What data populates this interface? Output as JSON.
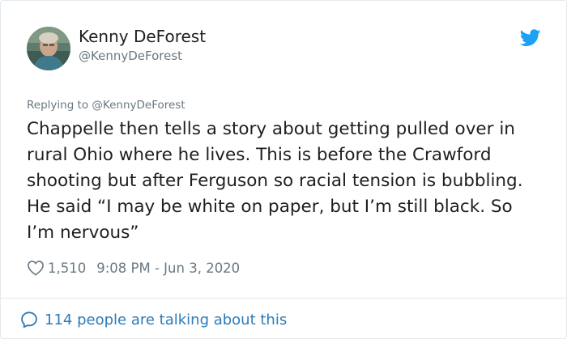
{
  "user": {
    "name": "Kenny DeForest",
    "handle": "@KennyDeForest"
  },
  "reply": {
    "prefix": "Replying to",
    "to": "@KennyDeForest"
  },
  "tweet": {
    "text": "Chappelle then tells a story about getting pulled over in rural Ohio where he lives. This is before the Crawford shooting but after Ferguson so racial tension is bubbling. He said “I may be white on paper, but I’m still black. So I’m nervous”"
  },
  "meta": {
    "likes": "1,510",
    "timestamp": "9:08 PM - Jun 3, 2020"
  },
  "footer": {
    "talking": "114 people are talking about this"
  },
  "colors": {
    "twitter_blue": "#1da1f2",
    "link_blue": "#2b7bb9",
    "secondary_text": "#697882",
    "primary_text": "#1c2022",
    "border": "#e1e8ed"
  },
  "icons": {
    "brand": "twitter-bird-icon",
    "like": "heart-icon",
    "conversation": "speech-bubble-icon"
  }
}
